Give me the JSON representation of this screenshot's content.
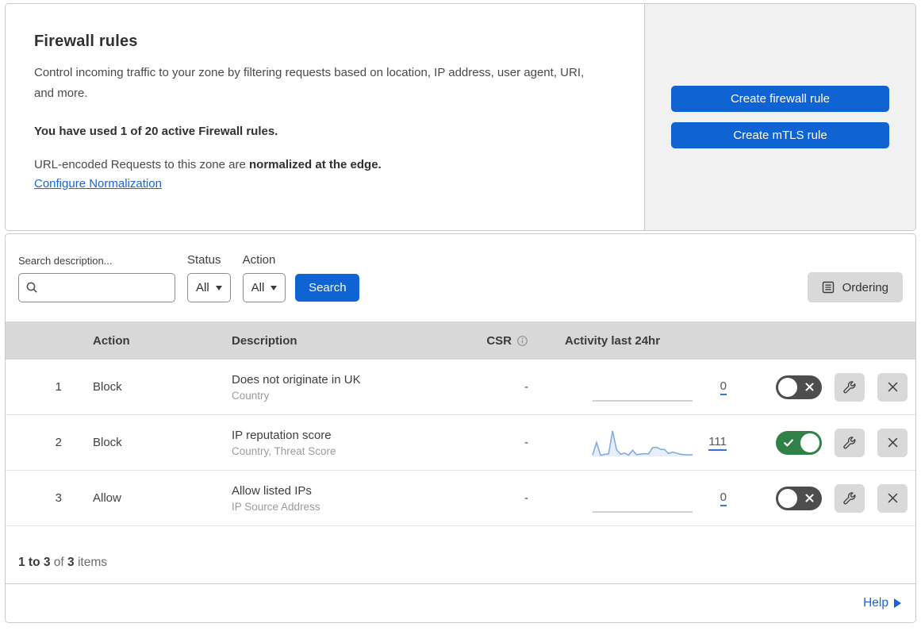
{
  "colors": {
    "accent_blue": "#1063d2",
    "link_blue": "#1b63d6",
    "toggle_on_green": "#2f8148",
    "toggle_off_gray": "#4d4d4d",
    "table_header_gray": "#d8d8d8",
    "panel_gray": "#f1f1f1"
  },
  "header": {
    "title": "Firewall rules",
    "description": "Control incoming traffic to your zone by filtering requests based on location, IP address, user agent, URI, and more.",
    "usage_bold": "You have used 1 of 20 active Firewall rules.",
    "normalization_text": "URL-encoded Requests to this zone are ",
    "normalization_bold": "normalized at the edge.",
    "normalization_link": "Configure Normalization",
    "create_firewall_button": "Create firewall rule",
    "create_mtls_button": "Create mTLS rule"
  },
  "filters": {
    "search_label": "Search description...",
    "search_value": "",
    "status_label": "Status",
    "status_value": "All",
    "action_label": "Action",
    "action_value": "All",
    "search_button": "Search",
    "ordering_button": "Ordering"
  },
  "table": {
    "columns": {
      "action": "Action",
      "description": "Description",
      "csr": "CSR",
      "activity": "Activity last 24hr"
    },
    "rows": [
      {
        "index": "1",
        "action": "Block",
        "description": "Does not originate in UK",
        "fields": "Country",
        "csr": "-",
        "count": "0",
        "enabled": false,
        "spark_color": "#c4c4c4",
        "spark_fill": "none",
        "spark": [
          0,
          0,
          0,
          0,
          0,
          0,
          0,
          0,
          0,
          0,
          0,
          0,
          0,
          0,
          0,
          0,
          0,
          0,
          0,
          0,
          0,
          0,
          0,
          0,
          0,
          0
        ]
      },
      {
        "index": "2",
        "action": "Block",
        "description": "IP reputation score",
        "fields": "Country, Threat Score",
        "csr": "-",
        "count": "111",
        "enabled": true,
        "spark_color": "#7da7e4",
        "spark_fill": "rgba(125,167,228,0.18)",
        "spark": [
          5,
          55,
          4,
          8,
          10,
          100,
          26,
          9,
          13,
          5,
          24,
          7,
          9,
          11,
          10,
          34,
          36,
          28,
          27,
          11,
          17,
          13,
          8,
          7,
          6,
          7
        ]
      },
      {
        "index": "3",
        "action": "Allow",
        "description": "Allow listed IPs",
        "fields": "IP Source Address",
        "csr": "-",
        "count": "0",
        "enabled": false,
        "spark_color": "#c4c4c4",
        "spark_fill": "none",
        "spark": [
          0,
          0,
          0,
          0,
          0,
          0,
          0,
          0,
          0,
          0,
          0,
          0,
          0,
          0,
          0,
          0,
          0,
          0,
          0,
          0,
          0,
          0,
          0,
          0,
          0,
          0
        ]
      }
    ]
  },
  "footer": {
    "range_bold": "1 to 3",
    "of_text": "of",
    "total_bold": "3",
    "items_text": "items",
    "help_label": "Help"
  }
}
